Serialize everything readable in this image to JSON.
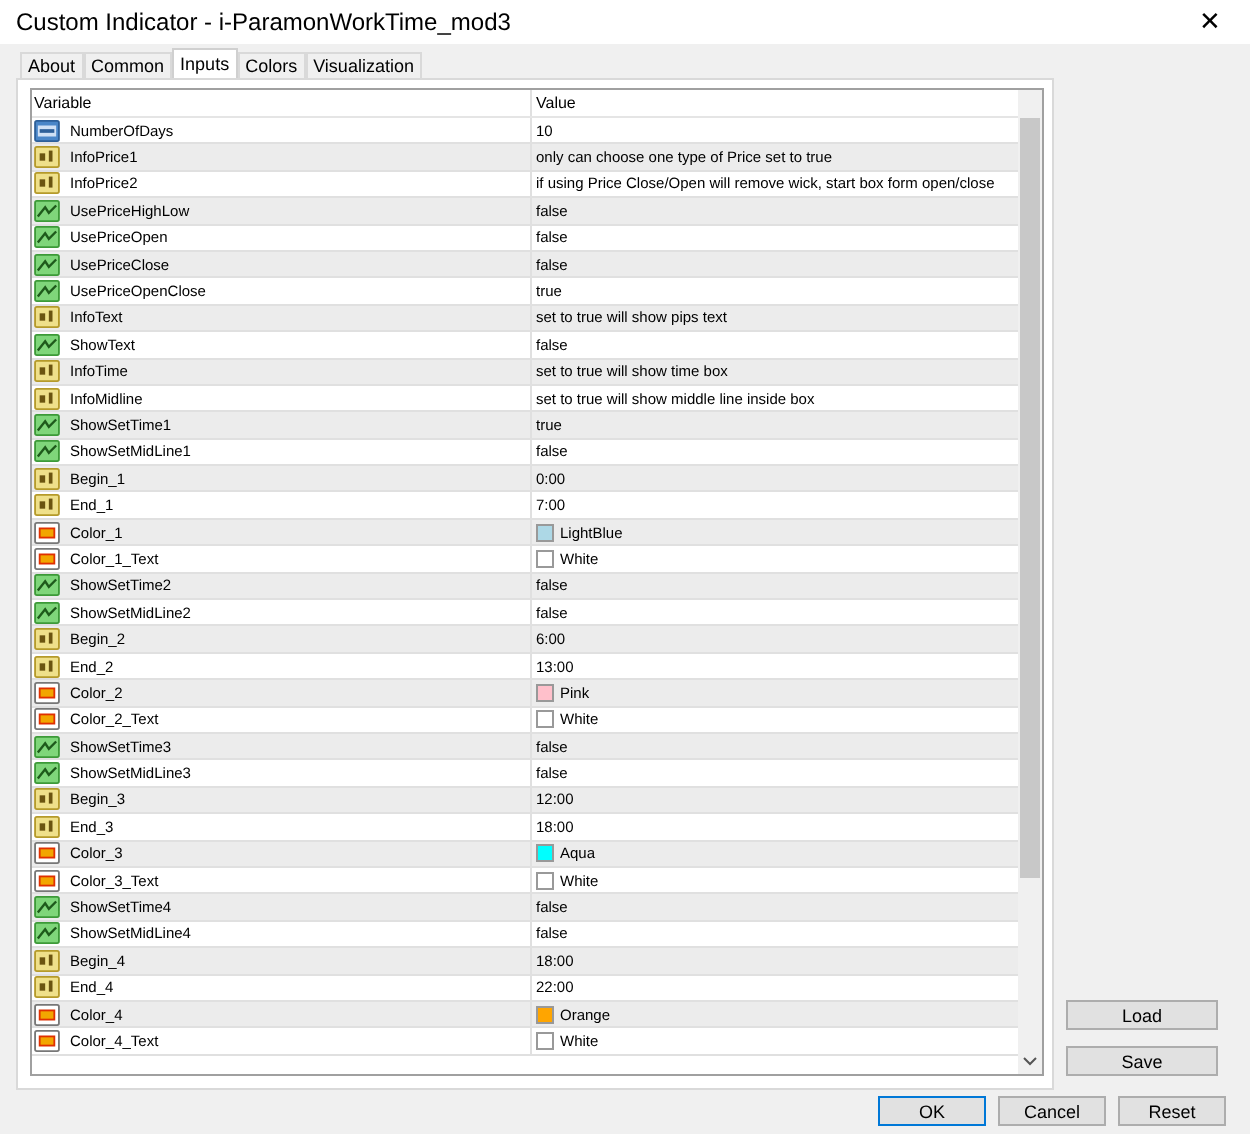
{
  "window": {
    "title": "Custom Indicator - i-ParamonWorkTime_mod3",
    "close": "✕"
  },
  "tabs": [
    {
      "label": "About",
      "selected": false
    },
    {
      "label": "Common",
      "selected": false
    },
    {
      "label": "Inputs",
      "selected": true
    },
    {
      "label": "Colors",
      "selected": false
    },
    {
      "label": "Visualization",
      "selected": false
    }
  ],
  "table": {
    "columns": [
      "Variable",
      "Value"
    ],
    "rows": [
      {
        "kind": "int",
        "variable": "NumberOfDays",
        "value": "10"
      },
      {
        "kind": "string",
        "variable": "InfoPrice1",
        "value": "only can choose one type of Price set to true"
      },
      {
        "kind": "string",
        "variable": "InfoPrice2",
        "value": "if using Price Close/Open will remove wick, start box form open/close"
      },
      {
        "kind": "bool",
        "variable": "UsePriceHighLow",
        "value": "false"
      },
      {
        "kind": "bool",
        "variable": "UsePriceOpen",
        "value": "false"
      },
      {
        "kind": "bool",
        "variable": "UsePriceClose",
        "value": "false"
      },
      {
        "kind": "bool",
        "variable": "UsePriceOpenClose",
        "value": "true"
      },
      {
        "kind": "string",
        "variable": "InfoText",
        "value": "set to true will show pips text"
      },
      {
        "kind": "bool",
        "variable": "ShowText",
        "value": "false"
      },
      {
        "kind": "string",
        "variable": "InfoTime",
        "value": "set to true will show time box"
      },
      {
        "kind": "string",
        "variable": "InfoMidline",
        "value": "set to true will show middle line inside box"
      },
      {
        "kind": "bool",
        "variable": "ShowSetTime1",
        "value": "true"
      },
      {
        "kind": "bool",
        "variable": "ShowSetMidLine1",
        "value": "false"
      },
      {
        "kind": "string",
        "variable": "Begin_1",
        "value": "0:00"
      },
      {
        "kind": "string",
        "variable": "End_1",
        "value": "7:00"
      },
      {
        "kind": "color",
        "variable": "Color_1",
        "value": "LightBlue",
        "color": "#add8e6"
      },
      {
        "kind": "color",
        "variable": "Color_1_Text",
        "value": "White",
        "color": "#ffffff"
      },
      {
        "kind": "bool",
        "variable": "ShowSetTime2",
        "value": "false"
      },
      {
        "kind": "bool",
        "variable": "ShowSetMidLine2",
        "value": "false"
      },
      {
        "kind": "string",
        "variable": "Begin_2",
        "value": "6:00"
      },
      {
        "kind": "string",
        "variable": "End_2",
        "value": "13:00"
      },
      {
        "kind": "color",
        "variable": "Color_2",
        "value": "Pink",
        "color": "#ffc0cb"
      },
      {
        "kind": "color",
        "variable": "Color_2_Text",
        "value": "White",
        "color": "#ffffff"
      },
      {
        "kind": "bool",
        "variable": "ShowSetTime3",
        "value": "false"
      },
      {
        "kind": "bool",
        "variable": "ShowSetMidLine3",
        "value": "false"
      },
      {
        "kind": "string",
        "variable": "Begin_3",
        "value": "12:00"
      },
      {
        "kind": "string",
        "variable": "End_3",
        "value": "18:00"
      },
      {
        "kind": "color",
        "variable": "Color_3",
        "value": "Aqua",
        "color": "#00ffff"
      },
      {
        "kind": "color",
        "variable": "Color_3_Text",
        "value": "White",
        "color": "#ffffff"
      },
      {
        "kind": "bool",
        "variable": "ShowSetTime4",
        "value": "false"
      },
      {
        "kind": "bool",
        "variable": "ShowSetMidLine4",
        "value": "false"
      },
      {
        "kind": "string",
        "variable": "Begin_4",
        "value": "18:00"
      },
      {
        "kind": "string",
        "variable": "End_4",
        "value": "22:00"
      },
      {
        "kind": "color",
        "variable": "Color_4",
        "value": "Orange",
        "color": "#ffa500"
      },
      {
        "kind": "color",
        "variable": "Color_4_Text",
        "value": "White",
        "color": "#ffffff"
      }
    ]
  },
  "side_buttons": [
    "Load",
    "Save"
  ],
  "buttons": [
    {
      "label": "OK",
      "default": true
    },
    {
      "label": "Cancel",
      "default": false
    },
    {
      "label": "Reset",
      "default": false
    }
  ]
}
